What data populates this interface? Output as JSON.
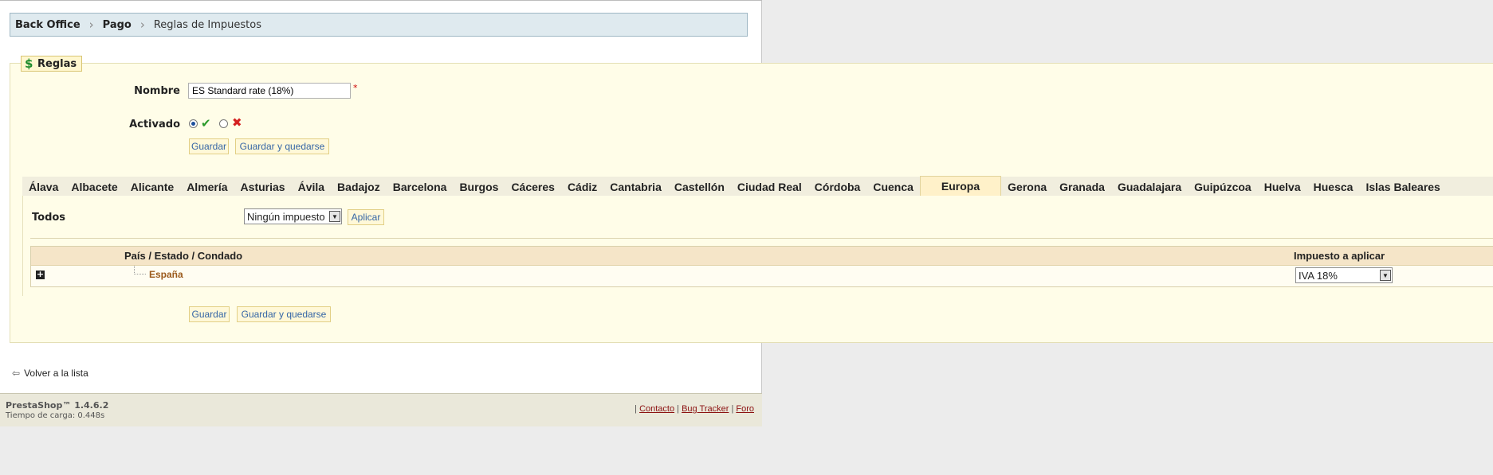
{
  "breadcrumb": {
    "items": [
      "Back Office",
      "Pago",
      "Reglas de Impuestos"
    ]
  },
  "section": {
    "legend": "Reglas",
    "legend_icon": "dollar-icon"
  },
  "form": {
    "name_label": "Nombre",
    "name_value": "ES Standard rate (18%)",
    "required_mark": "*",
    "active_label": "Activado",
    "active_selected": "yes",
    "save_label": "Guardar",
    "save_stay_label": "Guardar y quedarse"
  },
  "tabs": {
    "items": [
      "Álava",
      "Albacete",
      "Alicante",
      "Almería",
      "Asturias",
      "Ávila",
      "Badajoz",
      "Barcelona",
      "Burgos",
      "Cáceres",
      "Cádiz",
      "Cantabria",
      "Castellón",
      "Ciudad Real",
      "Córdoba",
      "Cuenca",
      "Europa",
      "Gerona",
      "Granada",
      "Guadalajara",
      "Guipúzcoa",
      "Huelva",
      "Huesca",
      "Islas Baleares"
    ],
    "active": "Europa"
  },
  "bulk": {
    "label": "Todos",
    "select_value": "Ningún impuesto",
    "apply_label": "Aplicar"
  },
  "table": {
    "col_country": "País / Estado / Condado",
    "col_tax": "Impuesto a aplicar",
    "rows": [
      {
        "country": "España",
        "tax": "IVA 18%"
      }
    ]
  },
  "back": {
    "label": "Volver a la lista"
  },
  "footer": {
    "brand": "PrestaShop™ 1.4.6.2",
    "load_time": "Tiempo de carga: 0.448s",
    "sep": "|",
    "links": [
      "Contacto",
      "Bug Tracker",
      "Foro"
    ]
  }
}
